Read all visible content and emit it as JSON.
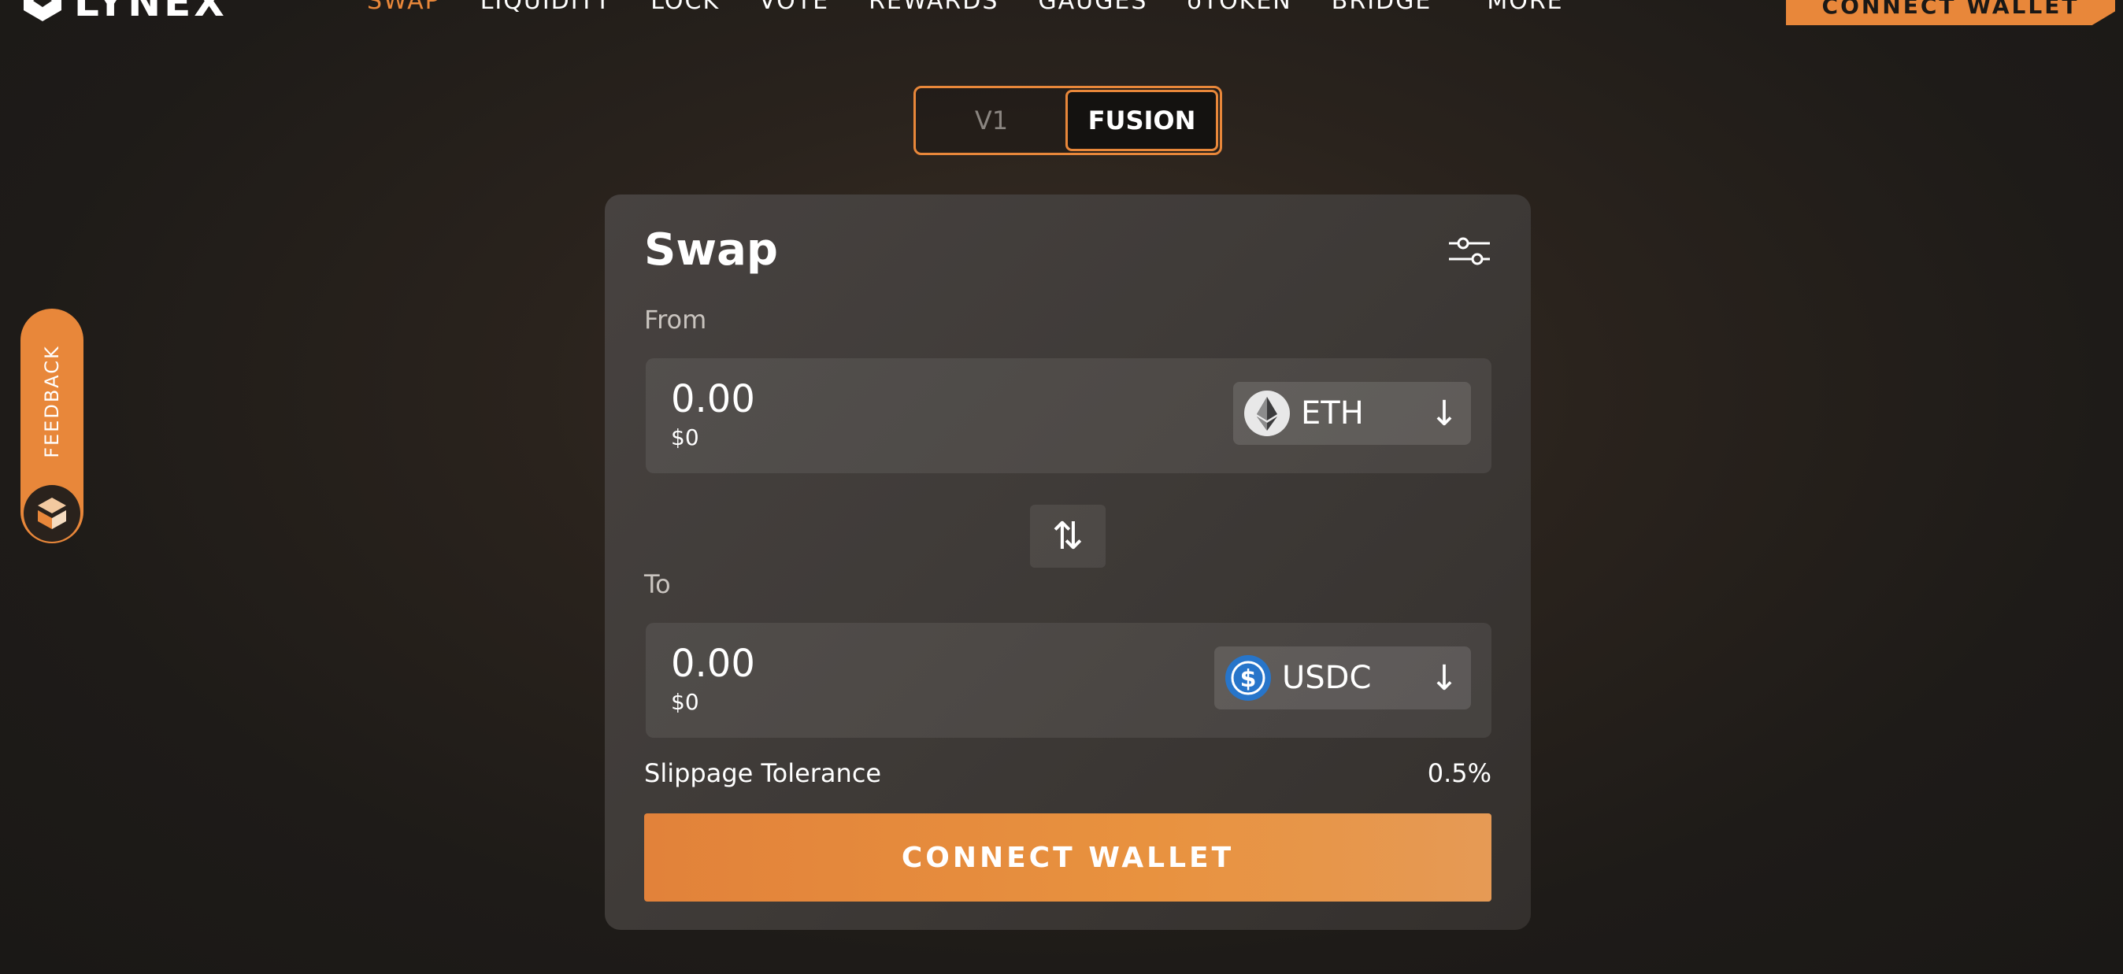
{
  "nav": {
    "logo_text": "LYNEX",
    "items": [
      {
        "label": "SWAP",
        "active": true
      },
      {
        "label": "LIQUIDITY",
        "active": false
      },
      {
        "label": "LOCK",
        "active": false
      },
      {
        "label": "VOTE",
        "active": false
      },
      {
        "label": "REWARDS",
        "active": false
      },
      {
        "label": "GAUGES",
        "active": false
      },
      {
        "label": "oTOKEN",
        "active": false
      },
      {
        "label": "BRIDGE",
        "active": false
      },
      {
        "label": "MORE",
        "active": false
      }
    ],
    "connect_label": "CONNECT WALLET"
  },
  "version_toggle": {
    "options": [
      "V1",
      "FUSION"
    ],
    "selected": "FUSION"
  },
  "swap": {
    "title": "Swap",
    "from": {
      "label": "From",
      "amount": "0.00",
      "usd": "$0",
      "token": "ETH",
      "token_icon": "eth-icon"
    },
    "to": {
      "label": "To",
      "amount": "0.00",
      "usd": "$0",
      "token": "USDC",
      "token_icon": "usdc-icon"
    },
    "slippage_label": "Slippage Tolerance",
    "slippage_value": "0.5%",
    "connect_label": "CONNECT WALLET"
  },
  "feedback": {
    "label": "FEEDBACK"
  },
  "colors": {
    "accent": "#e8873a",
    "background": "#1e1b18",
    "card": "#413c39"
  }
}
